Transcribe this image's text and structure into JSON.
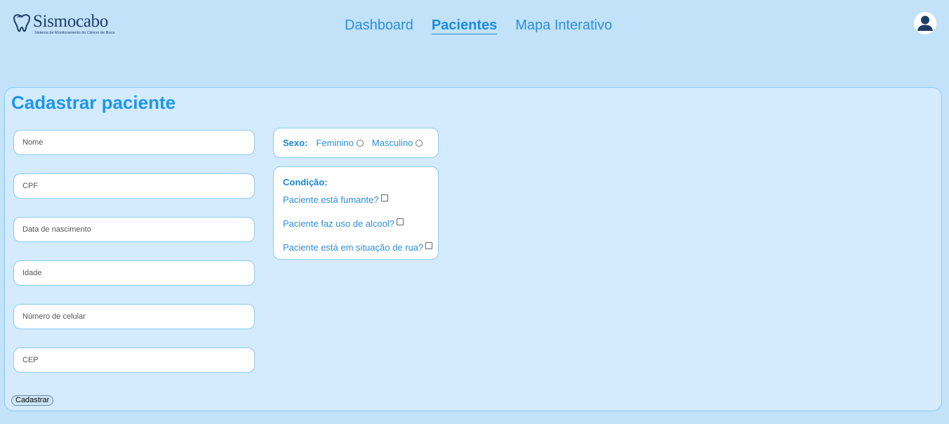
{
  "header": {
    "logo_name": "Sismocabo",
    "logo_subtitle": "Sistema de Monitoramento do Câncer de Boca",
    "nav": [
      {
        "label": "Dashboard",
        "active": false
      },
      {
        "label": "Pacientes",
        "active": true
      },
      {
        "label": "Mapa Interativo",
        "active": false
      }
    ],
    "user_icon": "user-avatar-icon"
  },
  "form": {
    "title": "Cadastrar paciente",
    "fields": {
      "nome": {
        "placeholder": "Nome",
        "value": ""
      },
      "cpf": {
        "placeholder": "CPF",
        "value": ""
      },
      "nascimento": {
        "placeholder": "Data de nascimento",
        "value": ""
      },
      "idade": {
        "placeholder": "Idade",
        "value": ""
      },
      "celular": {
        "placeholder": "Número de celular",
        "value": ""
      },
      "cep": {
        "placeholder": "CEP",
        "value": ""
      }
    },
    "sexo": {
      "label": "Sexo:",
      "options": [
        "Feminino",
        "Masculino"
      ],
      "selected": null
    },
    "condicao": {
      "label": "Condição:",
      "items": [
        {
          "label": "Paciente está fumante?",
          "checked": false
        },
        {
          "label": "Paciente faz uso de alcool?",
          "checked": false
        },
        {
          "label": "Paciente está em situação de rua?",
          "checked": false
        }
      ]
    },
    "submit_label": "Cadastrar"
  },
  "colors": {
    "background": "#c2e2fa",
    "card": "#d3ebfd",
    "accent": "#1e96ea",
    "logo": "#1c3d66",
    "border": "#8ccbef"
  }
}
